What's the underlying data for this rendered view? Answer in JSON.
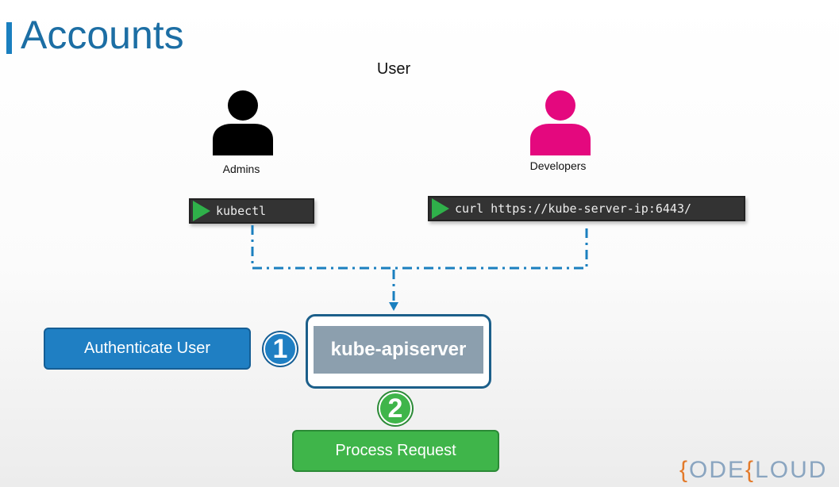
{
  "title": "Accounts",
  "user_title": "User",
  "admins": {
    "label": "Admins",
    "color": "#000000"
  },
  "developers": {
    "label": "Developers",
    "color": "#e4087e"
  },
  "terminals": {
    "admin_cmd": "kubectl",
    "developer_cmd": "curl https://kube-server-ip:6443/"
  },
  "auth": {
    "label": "Authenticate User",
    "step": "1"
  },
  "apiserver": {
    "label": "kube-apiserver"
  },
  "process": {
    "label": "Process Request",
    "step": "2"
  },
  "logo": {
    "brace1": "{",
    "part1": "ODE",
    "brace2": "{",
    "part2": "LOUD"
  },
  "colors": {
    "accent_blue": "#1f7fc3",
    "accent_green": "#3fb54a",
    "connector": "#1a7fbf",
    "title": "#1c6ea4"
  }
}
